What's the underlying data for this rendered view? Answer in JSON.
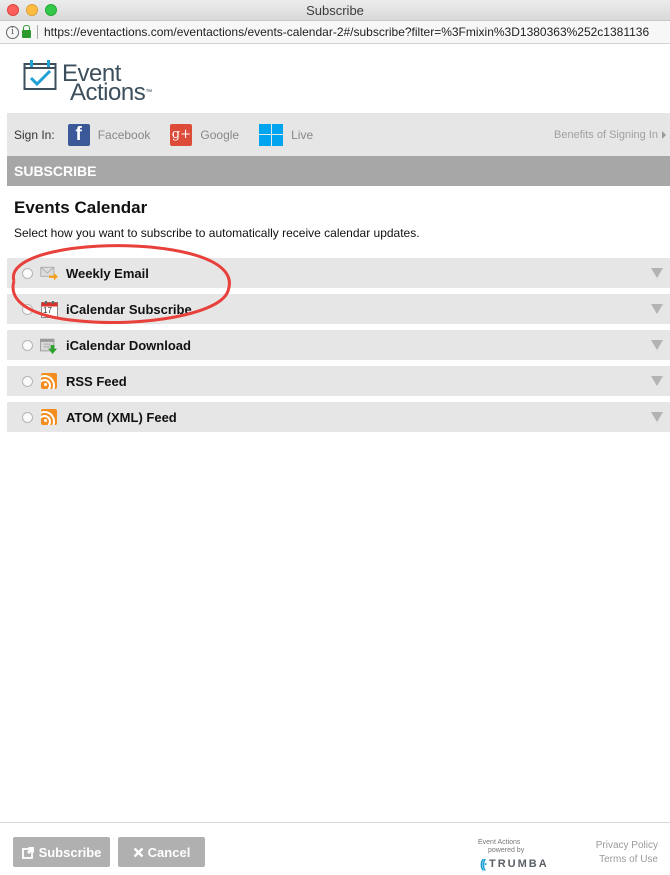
{
  "window": {
    "title": "Subscribe"
  },
  "browser": {
    "url": "https://eventactions.com/eventactions/events-calendar-2#/subscribe?filter=%3Fmixin%3D1380363%252c1381136"
  },
  "logo": {
    "line1": "Event",
    "line2": "Actions",
    "tm": "™"
  },
  "signin": {
    "label": "Sign In:",
    "providers": [
      {
        "name": "Facebook",
        "icon": "facebook-icon",
        "color": "#3b5998"
      },
      {
        "name": "Google",
        "icon": "google-plus-icon",
        "color": "#dd4b39"
      },
      {
        "name": "Live",
        "icon": "windows-live-icon",
        "color": "#00a4ef"
      }
    ],
    "benefits": "Benefits of Signing In"
  },
  "section": {
    "header": "SUBSCRIBE"
  },
  "calendar": {
    "title": "Events Calendar",
    "description": "Select how you want to subscribe to automatically receive calendar updates."
  },
  "options": [
    {
      "label": "Weekly Email",
      "icon": "email-icon"
    },
    {
      "label": "iCalendar Subscribe",
      "icon": "calendar-icon",
      "icon_text": "17"
    },
    {
      "label": "iCalendar Download",
      "icon": "calendar-download-icon"
    },
    {
      "label": "RSS Feed",
      "icon": "rss-icon"
    },
    {
      "label": "ATOM (XML) Feed",
      "icon": "rss-icon"
    }
  ],
  "footer": {
    "subscribe_label": "Subscribe",
    "cancel_label": "Cancel",
    "powered_line1": "Event Actions",
    "powered_line2": "powered by",
    "trumba": "TRUMBA",
    "privacy": "Privacy Policy",
    "terms": "Terms of Use"
  },
  "colors": {
    "accent_red": "#e8403a",
    "header_gray": "#a7a7a7",
    "button_gray": "#b0b0b0"
  }
}
